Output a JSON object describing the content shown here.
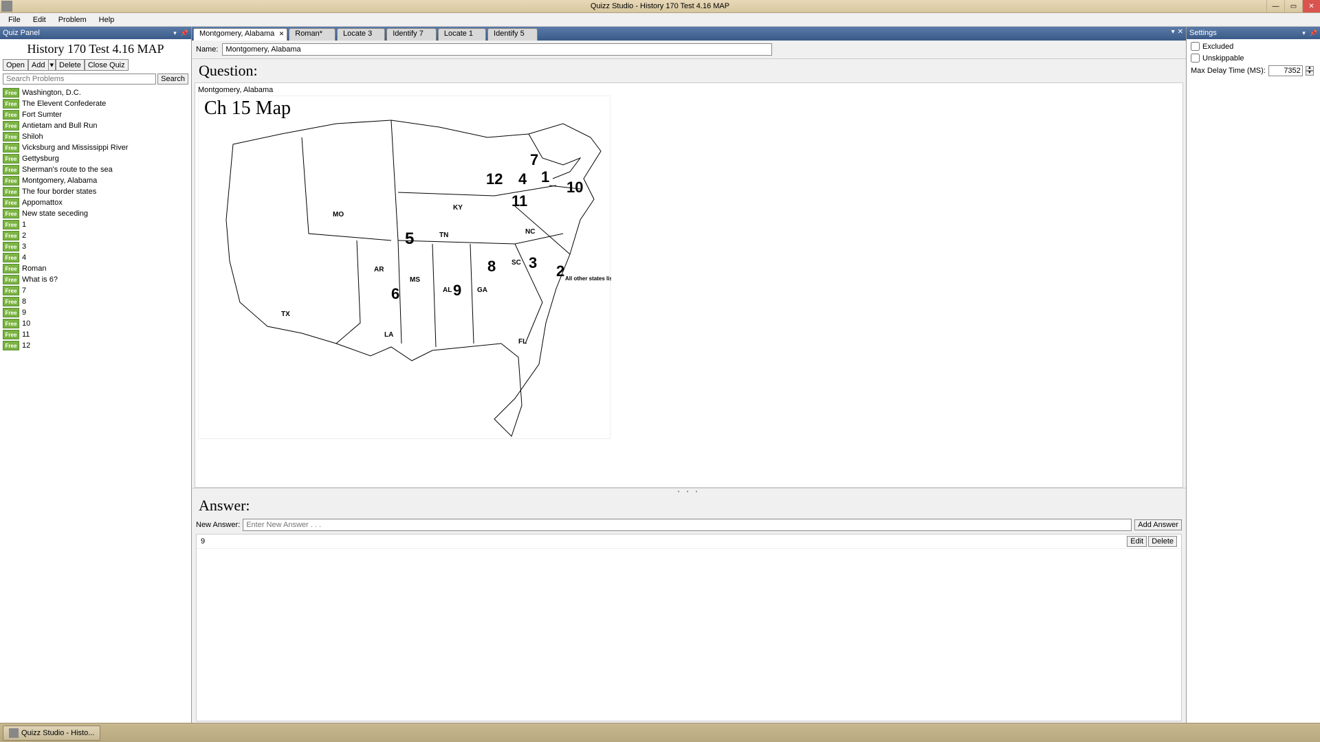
{
  "titlebar": {
    "title": "Quizz Studio  - History 170 Test 4.16 MAP"
  },
  "menubar": [
    "File",
    "Edit",
    "Problem",
    "Help"
  ],
  "quiz_panel": {
    "header": "Quiz Panel",
    "title": "History 170 Test 4.16 MAP",
    "toolbar": {
      "open": "Open",
      "add": "Add",
      "delete": "Delete",
      "close": "Close Quiz"
    },
    "search_placeholder": "Search Problems",
    "search_btn": "Search",
    "badge": "Free",
    "problems": [
      "Washington, D.C.",
      "The Elevent Confederate",
      "Fort Sumter",
      "Antietam and Bull Run",
      "Shiloh",
      "Vicksburg and Mississippi River",
      "Gettysburg",
      "Sherman's route to the sea",
      "Montgomery, Alabama",
      "The four border states",
      "Appomattox",
      "New state seceding",
      "1",
      "2",
      "3",
      "4",
      "Roman",
      "What is 6?",
      "7",
      "8",
      "9",
      "10",
      "11",
      "12"
    ]
  },
  "tabs": [
    {
      "label": "Montgomery, Alabama",
      "active": true
    },
    {
      "label": "Roman*",
      "active": false
    },
    {
      "label": "Locate 3",
      "active": false
    },
    {
      "label": "Identify 7",
      "active": false
    },
    {
      "label": "Locate 1",
      "active": false
    },
    {
      "label": "Identify 5",
      "active": false
    }
  ],
  "name_row": {
    "label": "Name:",
    "value": "Montgomery, Alabama"
  },
  "question": {
    "heading": "Question:",
    "text": "Montgomery, Alabama",
    "map_title": "Ch 15 Map",
    "map_note": "All other states listed",
    "labels": {
      "MO": "MO",
      "KY": "KY",
      "TN": "TN",
      "NC": "NC",
      "SC": "SC",
      "AR": "AR",
      "MS": "MS",
      "AL": "AL",
      "GA": "GA",
      "LA": "LA",
      "TX": "TX",
      "FL": "FL"
    },
    "numbers": [
      "1",
      "2",
      "3",
      "4",
      "5",
      "6",
      "7",
      "8",
      "9",
      "10",
      "11",
      "12"
    ]
  },
  "answer": {
    "heading": "Answer:",
    "new_label": "New Answer:",
    "new_placeholder": "Enter New Answer . . .",
    "add_btn": "Add Answer",
    "items": [
      {
        "value": "9",
        "edit": "Edit",
        "delete": "Delete"
      }
    ]
  },
  "settings": {
    "header": "Settings",
    "excluded": "Excluded",
    "unskippable": "Unskippable",
    "delay_label": "Max Delay Time (MS):",
    "delay_value": "7352"
  },
  "taskbar": {
    "btn": "Quizz Studio  - Histo..."
  }
}
